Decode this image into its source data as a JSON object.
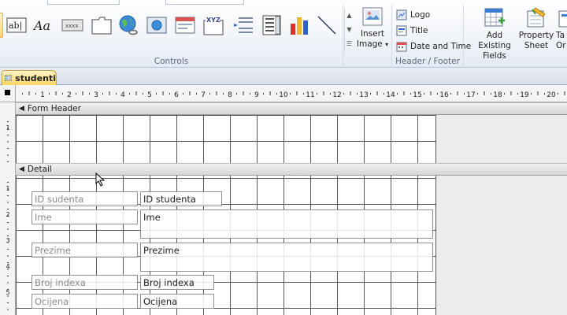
{
  "ribbon": {
    "controls_group_label": "Controls",
    "header_footer_group_label": "Header / Footer",
    "insert_image_label_1": "Insert",
    "insert_image_label_2": "Image",
    "insert_image_caret": "▾",
    "logo_label": "Logo",
    "title_label": "Title",
    "date_time_label": "Date and Time",
    "add_existing_label_1": "Add Existing",
    "add_existing_label_2": "Fields",
    "property_sheet_label_1": "Property",
    "property_sheet_label_2": "Sheet",
    "tab_order_label_1": "Ta",
    "tab_order_label_2": "Or",
    "textbox_icon_text": "ab|",
    "label_icon_text": "Aa",
    "button_icon_text": "xxxx",
    "combo_icon_text": "XYZ",
    "colors": {
      "accent_chart_red": "#d9312b",
      "accent_chart_blue": "#2f62c8",
      "accent_chart_yellow": "#f3b630"
    }
  },
  "document_tab": {
    "label": "studenti"
  },
  "sections": {
    "form_header": "Form Header",
    "detail": "Detail"
  },
  "fields": [
    {
      "label": "ID sudenta",
      "textbox": "ID studenta"
    },
    {
      "label": "Ime",
      "textbox": "Ime"
    },
    {
      "label": "Prezime",
      "textbox": "Prezime"
    },
    {
      "label": "Broj indexa",
      "textbox": "Broj indexa"
    },
    {
      "label": "Ocijena",
      "textbox": "Ocijena"
    }
  ],
  "ruler": {
    "h_numbers": [
      "1",
      "2",
      "3",
      "4",
      "5",
      "6",
      "7",
      "8",
      "9",
      "10",
      "11",
      "12",
      "13",
      "14",
      "15",
      "16",
      "17",
      "18",
      "19",
      "20"
    ],
    "v_header_numbers": [
      "1"
    ],
    "v_detail_numbers": [
      "1",
      "2",
      "3",
      "4",
      "5"
    ]
  }
}
